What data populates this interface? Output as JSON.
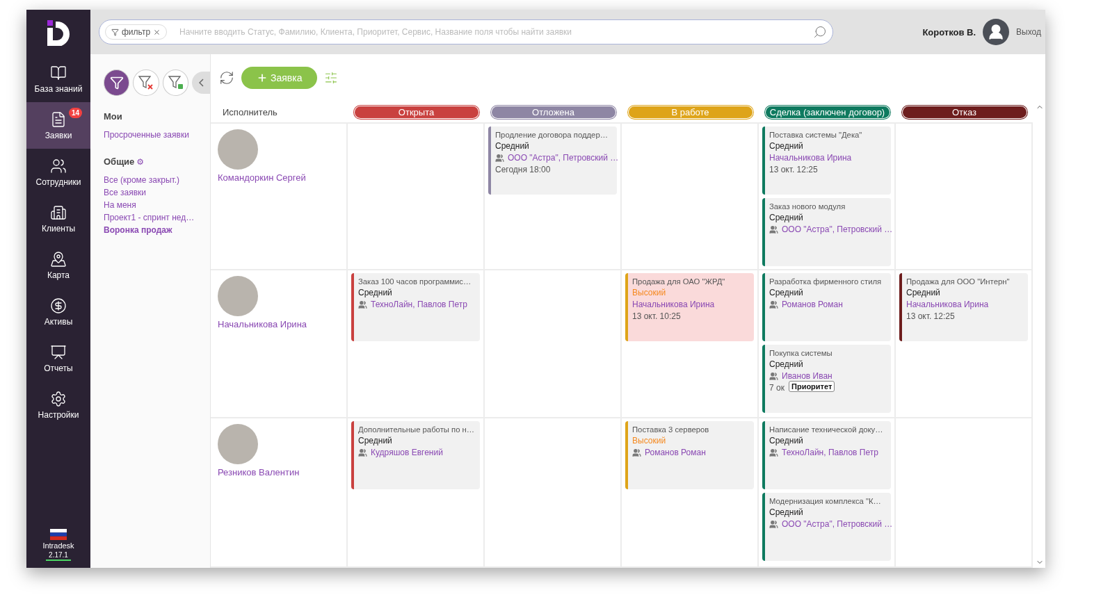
{
  "nav": {
    "items": [
      {
        "kind": "book",
        "label": "База знаний",
        "selected": false
      },
      {
        "kind": "file",
        "label": "Заявки",
        "selected": true,
        "badge": "14"
      },
      {
        "kind": "users",
        "label": "Сотрудники",
        "selected": false
      },
      {
        "kind": "building",
        "label": "Клиенты",
        "selected": false
      },
      {
        "kind": "map",
        "label": "Карта",
        "selected": false
      },
      {
        "kind": "money",
        "label": "Активы",
        "selected": false
      },
      {
        "kind": "report",
        "label": "Отчеты",
        "selected": false
      },
      {
        "kind": "settings",
        "label": "Настройки",
        "selected": false
      }
    ],
    "product": "Intradesk",
    "version": "2.17.1"
  },
  "topbar": {
    "filter_chip": "фильтр",
    "search_placeholder": "Начните вводить Статус, Фамилию, Клиента, Приоритет, Сервис, Название поля чтобы найти заявки",
    "user": "Коротков В.",
    "logout": "Выход"
  },
  "filters": {
    "buttons": [
      {
        "kind": "filter",
        "selected": true
      },
      {
        "kind": "clear",
        "selected": false
      },
      {
        "kind": "save",
        "selected": false
      }
    ],
    "sections": [
      {
        "title": "Мои",
        "items": [
          {
            "label": "Просроченные заявки",
            "selected": false
          }
        ]
      },
      {
        "title": "Общие",
        "icon": "⚙",
        "items": [
          {
            "label": "Все (кроме закрыт.)",
            "selected": false
          },
          {
            "label": "Все заявки",
            "selected": false
          },
          {
            "label": "На меня",
            "selected": false
          },
          {
            "label": "Проект1 - спринт нед…",
            "selected": false
          },
          {
            "label": "Воронка продаж",
            "selected": true
          }
        ]
      }
    ]
  },
  "toolbar": {
    "new_button": "Заявка"
  },
  "board": {
    "performer_header": "Исполнитель",
    "columns": [
      {
        "label": "Открыта",
        "color": "#c9413f"
      },
      {
        "label": "Отложена",
        "color": "#8e86a4"
      },
      {
        "label": "В работе",
        "color": "#dea419"
      },
      {
        "label": "Сделка (заключен договор)",
        "color": "#0e7a5f"
      },
      {
        "label": "Отказ",
        "color": "#6e1d1d"
      }
    ],
    "rows": [
      {
        "name": "Командоркин Сергей",
        "cells": [
          [],
          [
            {
              "title": "Продление договора поддер…",
              "priority": "Средний",
              "high": false,
              "highlighted": false,
              "assignee": "ООО \"Астра\", Петровский …",
              "group": true,
              "date": "Сегодня 18:00"
            }
          ],
          [],
          [
            {
              "title": "Поставка системы \"Дека\"",
              "priority": "Средний",
              "high": false,
              "highlighted": false,
              "assignee": "Начальникова Ирина",
              "group": false,
              "date": "13 окт. 12:25"
            },
            {
              "title": "Заказ нового модуля",
              "priority": "Средний",
              "high": false,
              "highlighted": false,
              "assignee": "ООО \"Астра\", Петровский …",
              "group": true
            }
          ],
          []
        ]
      },
      {
        "name": "Начальникова Ирина",
        "cells": [
          [
            {
              "title": "Заказ 100 часов программис…",
              "priority": "Средний",
              "high": false,
              "highlighted": false,
              "assignee": "ТехноЛайн, Павлов Петр",
              "group": true
            }
          ],
          [],
          [
            {
              "title": "Продажа для ОАО \"ЖРД\"",
              "priority": "Высокий",
              "high": true,
              "highlighted": true,
              "assignee": "Начальникова Ирина",
              "group": false,
              "date": "13 окт. 10:25"
            }
          ],
          [
            {
              "title": "Разработка фирменного стиля",
              "priority": "Средний",
              "high": false,
              "highlighted": false,
              "assignee": "Романов Роман",
              "group": true
            },
            {
              "title": "Покупка системы",
              "priority": "Средний",
              "high": false,
              "highlighted": false,
              "assignee": "Иванов Иван",
              "group": true,
              "date": "7 ок",
              "tooltip": "Приоритет"
            }
          ],
          [
            {
              "title": "Продажа для ООО \"Интерн\"",
              "priority": "Средний",
              "high": false,
              "highlighted": false,
              "assignee": "Начальникова Ирина",
              "group": false,
              "date": "13 окт. 12:25"
            }
          ]
        ]
      },
      {
        "name": "Резников Валентин",
        "cells": [
          [
            {
              "title": "Дополнительные работы по н…",
              "priority": "Средний",
              "high": false,
              "highlighted": false,
              "assignee": "Кудряшов Евгений",
              "group": true
            }
          ],
          [],
          [
            {
              "title": "Поставка 3 серверов",
              "priority": "Высокий",
              "high": true,
              "highlighted": false,
              "assignee": "Романов Роман",
              "group": true
            }
          ],
          [
            {
              "title": "Написание технической доку…",
              "priority": "Средний",
              "high": false,
              "highlighted": false,
              "assignee": "ТехноЛайн, Павлов Петр",
              "group": true
            },
            {
              "title": "Модернизация комплекса \"К…",
              "priority": "Средний",
              "high": false,
              "highlighted": false,
              "assignee": "ООО \"Астра\", Петровский …",
              "group": true
            }
          ],
          []
        ]
      }
    ]
  }
}
